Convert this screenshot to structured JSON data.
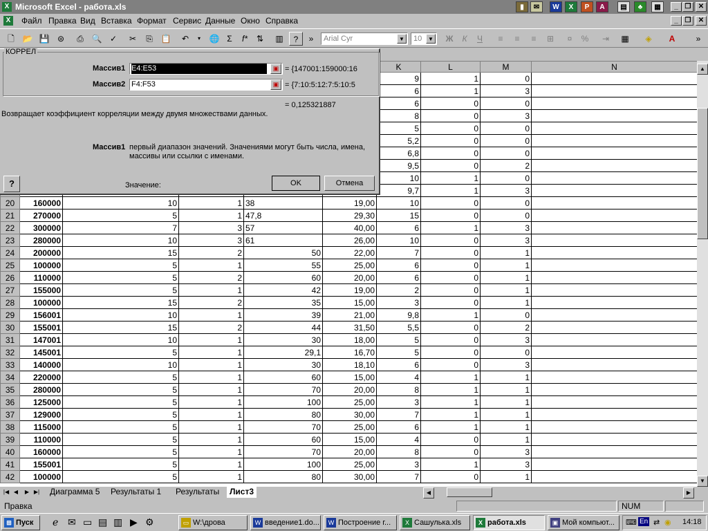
{
  "window": {
    "title": "Microsoft Excel - работа.xls",
    "app_icon": "excel-icon"
  },
  "menu": [
    "Файл",
    "Правка",
    "Вид",
    "Вставка",
    "Формат",
    "Сервис",
    "Данные",
    "Окно",
    "Справка"
  ],
  "toolbar": {
    "font_name": "Arial Cyr",
    "font_size": "10",
    "bold_label": "Ж",
    "italic_label": "К",
    "underline_label": "Ч",
    "sum_label": "Σ",
    "fx_label": "f*",
    "percent_label": "%"
  },
  "dialog": {
    "title": "КОРРЕЛ",
    "arg1_label": "Массив1",
    "arg1_value": "E4:E53",
    "arg1_result": "= {147001:159000:16",
    "arg2_label": "Массив2",
    "arg2_value": "F4:F53",
    "arg2_result": "= {7:10:5:12:7:5:10:5",
    "result": "= 0,125321887",
    "description": "Возвращает коэффициент корреляции между двумя множествами данных.",
    "arg_help_name": "Массив1",
    "arg_help_text_1": "первый диапазон значений. Значениями могут быть числа, имена,",
    "arg_help_text_2": "массивы или ссылки с именами.",
    "value_label": "Значение:",
    "ok_label": "OK",
    "cancel_label": "Отмена"
  },
  "columns": [
    "K",
    "L",
    "M",
    "N"
  ],
  "top_rows": [
    {
      "k": "9",
      "l": "1",
      "m": "0"
    },
    {
      "k": "6",
      "l": "1",
      "m": "3"
    },
    {
      "k": "6",
      "l": "0",
      "m": "0"
    },
    {
      "k": "8",
      "l": "0",
      "m": "3"
    },
    {
      "k": "5",
      "l": "0",
      "m": "0"
    },
    {
      "k": "5,2",
      "l": "0",
      "m": "0"
    },
    {
      "k": "6,8",
      "l": "0",
      "m": "0"
    },
    {
      "k": "9,5",
      "l": "0",
      "m": "2"
    },
    {
      "k": "10",
      "l": "1",
      "m": "0"
    },
    {
      "k": "9,7",
      "l": "1",
      "m": "3"
    }
  ],
  "rows": [
    {
      "n": "20",
      "a": "160000",
      "b": "10",
      "c": "1",
      "d": "38",
      "dl": true,
      "e": "19,00",
      "k": "10",
      "l": "0",
      "m": "0"
    },
    {
      "n": "21",
      "a": "270000",
      "b": "5",
      "c": "1",
      "d": "47,8",
      "dl": true,
      "e": "29,30",
      "k": "15",
      "l": "0",
      "m": "0"
    },
    {
      "n": "22",
      "a": "300000",
      "b": "7",
      "c": "3",
      "d": "57",
      "dl": true,
      "e": "40,00",
      "k": "6",
      "l": "1",
      "m": "3"
    },
    {
      "n": "23",
      "a": "280000",
      "b": "10",
      "c": "3",
      "d": "61",
      "dl": true,
      "e": "26,00",
      "k": "10",
      "l": "0",
      "m": "3"
    },
    {
      "n": "24",
      "a": "200000",
      "b": "15",
      "c": "2",
      "d": "50",
      "e": "22,00",
      "k": "7",
      "l": "0",
      "m": "1"
    },
    {
      "n": "25",
      "a": "100000",
      "b": "5",
      "c": "1",
      "d": "55",
      "e": "25,00",
      "k": "6",
      "l": "0",
      "m": "1"
    },
    {
      "n": "26",
      "a": "110000",
      "b": "5",
      "c": "2",
      "d": "60",
      "e": "20,00",
      "k": "6",
      "l": "0",
      "m": "1"
    },
    {
      "n": "27",
      "a": "155000",
      "b": "5",
      "c": "1",
      "d": "42",
      "e": "19,00",
      "k": "2",
      "l": "0",
      "m": "1"
    },
    {
      "n": "28",
      "a": "100000",
      "b": "15",
      "c": "2",
      "d": "35",
      "e": "15,00",
      "k": "3",
      "l": "0",
      "m": "1"
    },
    {
      "n": "29",
      "a": "156001",
      "b": "10",
      "c": "1",
      "d": "39",
      "e": "21,00",
      "k": "9,8",
      "l": "1",
      "m": "0"
    },
    {
      "n": "30",
      "a": "155001",
      "b": "15",
      "c": "2",
      "d": "44",
      "e": "31,50",
      "k": "5,5",
      "l": "0",
      "m": "2"
    },
    {
      "n": "31",
      "a": "147001",
      "b": "10",
      "c": "1",
      "d": "30",
      "e": "18,00",
      "k": "5",
      "l": "0",
      "m": "3"
    },
    {
      "n": "32",
      "a": "145001",
      "b": "5",
      "c": "1",
      "d": "29,1",
      "e": "16,70",
      "k": "5",
      "l": "0",
      "m": "0"
    },
    {
      "n": "33",
      "a": "140000",
      "b": "10",
      "c": "1",
      "d": "30",
      "e": "18,10",
      "k": "6",
      "l": "0",
      "m": "3"
    },
    {
      "n": "34",
      "a": "220000",
      "b": "5",
      "c": "1",
      "d": "60",
      "e": "15,00",
      "k": "4",
      "l": "1",
      "m": "1"
    },
    {
      "n": "35",
      "a": "280000",
      "b": "5",
      "c": "1",
      "d": "70",
      "e": "20,00",
      "k": "8",
      "l": "1",
      "m": "1"
    },
    {
      "n": "36",
      "a": "125000",
      "b": "5",
      "c": "1",
      "d": "100",
      "e": "25,00",
      "k": "3",
      "l": "1",
      "m": "1"
    },
    {
      "n": "37",
      "a": "129000",
      "b": "5",
      "c": "1",
      "d": "80",
      "e": "30,00",
      "k": "7",
      "l": "1",
      "m": "1"
    },
    {
      "n": "38",
      "a": "115000",
      "b": "5",
      "c": "1",
      "d": "70",
      "e": "25,00",
      "k": "6",
      "l": "1",
      "m": "1"
    },
    {
      "n": "39",
      "a": "110000",
      "b": "5",
      "c": "1",
      "d": "60",
      "e": "15,00",
      "k": "4",
      "l": "0",
      "m": "1"
    },
    {
      "n": "40",
      "a": "160000",
      "b": "5",
      "c": "1",
      "d": "70",
      "e": "20,00",
      "k": "8",
      "l": "0",
      "m": "3"
    },
    {
      "n": "41",
      "a": "155001",
      "b": "5",
      "c": "1",
      "d": "100",
      "e": "25,00",
      "k": "3",
      "l": "1",
      "m": "3"
    },
    {
      "n": "42",
      "a": "100000",
      "b": "5",
      "c": "1",
      "d": "80",
      "e": "30,00",
      "k": "7",
      "l": "0",
      "m": "1"
    }
  ],
  "sheet_tabs": [
    "Диаграмма 5",
    "Результаты 1",
    "Результаты",
    "Лист3"
  ],
  "active_tab": "Лист3",
  "status": {
    "mode": "Правка",
    "num": "NUM"
  },
  "taskbar": {
    "start_label": "Пуск",
    "tasks": [
      "W:\\дрова",
      "введение1.do...",
      "Построение г...",
      "Сашулька.xls",
      "работа.xls",
      "Мой компьют..."
    ],
    "lang": "En",
    "clock": "14:18"
  },
  "colors": {
    "titlebar_inactive": "#808080",
    "face": "#c0c0c0",
    "selection": "#000000"
  }
}
